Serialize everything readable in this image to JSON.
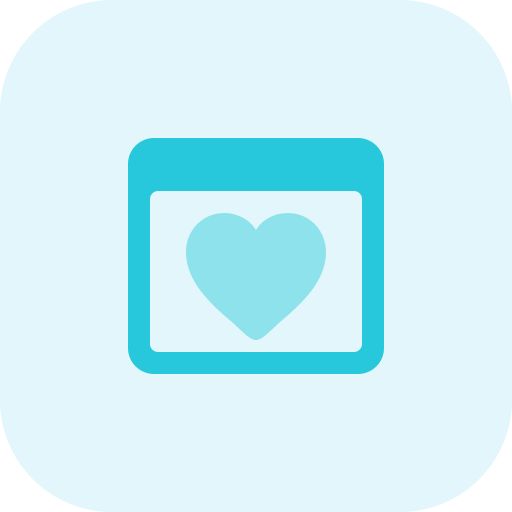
{
  "icon": {
    "name": "browser-window-heart-icon",
    "tile_color": "#e2f6fb",
    "window_color": "#27c7dc",
    "window_inner_color": "#e2f6fb",
    "heart_color": "#8ee2ec"
  }
}
